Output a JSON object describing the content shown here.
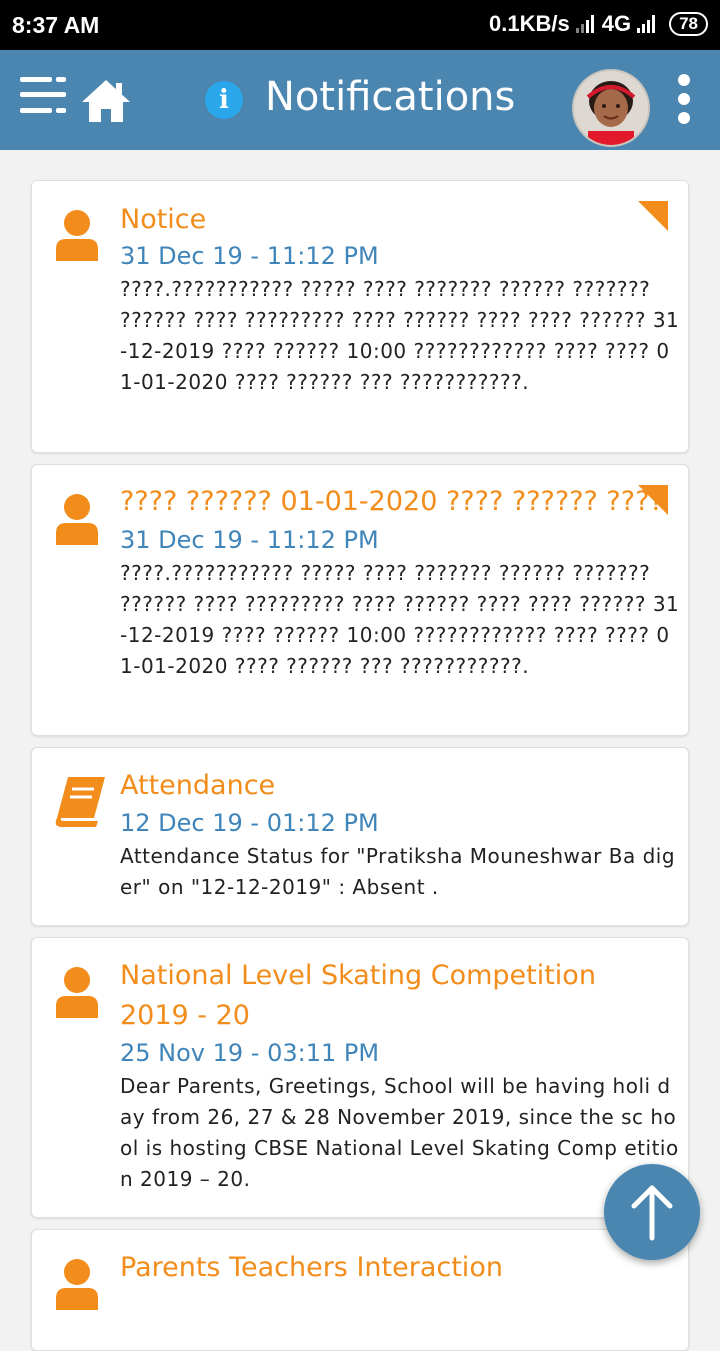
{
  "status_bar": {
    "time": "8:37 AM",
    "speed": "0.1KB/s",
    "network": "4G",
    "battery": "78"
  },
  "app_bar": {
    "title": "Notifications",
    "icons": [
      "menu-icon",
      "home-icon",
      "info-icon",
      "avatar",
      "more-vert-icon"
    ]
  },
  "notifications": [
    {
      "icon": "person-icon",
      "title": "Notice",
      "date": "31 Dec 19 - 11:12 PM",
      "body": "????.??????????? ????? ???? ??????? ?????? ??????? ?????? ???? ????????? ???? ?????? ???? ???? ?????? 31-12-2019 ???? ?????? 10:00 ???????????? ???? ???? 01-01-2020 ???? ?????? ??? ???????????.",
      "unread": true
    },
    {
      "icon": "person-icon",
      "title": "???? ?????? 01-01-2020 ???? ?????? ????",
      "date": "31 Dec 19 - 11:12 PM",
      "body": "????.??????????? ????? ???? ??????? ?????? ??????? ?????? ???? ????????? ???? ?????? ???? ???? ?????? 31-12-2019 ???? ?????? 10:00 ???????????? ???? ???? 01-01-2020 ???? ?????? ??? ???????????.",
      "unread": true
    },
    {
      "icon": "book-icon",
      "title": "Attendance",
      "date": "12 Dec 19 - 01:12 PM",
      "body": "Attendance Status for \"Pratiksha Mouneshwar Ba diger\" on \"12-12-2019\" : Absent .",
      "unread": false
    },
    {
      "icon": "person-icon",
      "title": "National Level Skating Competition 2019 - 20",
      "date": "25 Nov 19 - 03:11 PM",
      "body": "Dear Parents, Greetings, School will be having holi day from 26, 27 & 28 November 2019, since the sc hool is hosting CBSE National Level Skating Comp etition 2019 – 20.",
      "unread": false
    },
    {
      "icon": "person-icon",
      "title": "Parents Teachers Interaction",
      "date": "",
      "body": "",
      "unread": false
    }
  ],
  "colors": {
    "app_bar": "#4a86b0",
    "accent_orange": "#f28c1a",
    "date_blue": "#3f85b9"
  }
}
